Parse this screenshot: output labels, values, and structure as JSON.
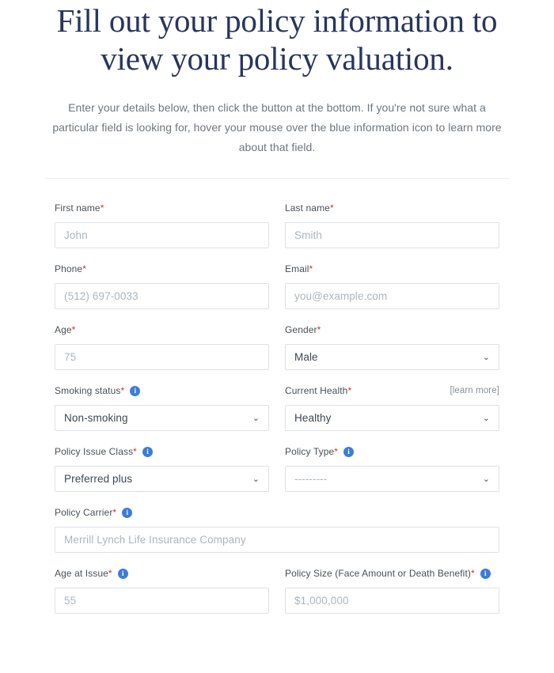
{
  "header": {
    "title": "Fill out your policy information to view your policy valuation.",
    "subtitle": "Enter your details below, then click the button at the bottom. If you're not sure what a particular field is looking for, hover your mouse over the blue information icon to learn more about that field."
  },
  "colors": {
    "heading": "#28355c",
    "subtitle": "#6e767d",
    "label": "#495057",
    "required_asterisk": "#c0392b",
    "info_icon": "#3b7dd8",
    "input_border": "#dee2e6",
    "placeholder": "#adb5bd",
    "value_text": "#3f4752",
    "divider": "#e9ecef"
  },
  "form": {
    "required_marker": "*",
    "info_icon_glyph": "i",
    "chevron_glyph": "⌄",
    "learn_more_label": "[learn more]",
    "fields": {
      "first_name": {
        "label": "First name",
        "placeholder": "John",
        "value": "",
        "type": "text",
        "required": true
      },
      "last_name": {
        "label": "Last name",
        "placeholder": "Smith",
        "value": "",
        "type": "text",
        "required": true
      },
      "phone": {
        "label": "Phone",
        "placeholder": "(512) 697-0033",
        "value": "",
        "type": "text",
        "required": true
      },
      "email": {
        "label": "Email",
        "placeholder": "you@example.com",
        "value": "",
        "type": "text",
        "required": true
      },
      "age": {
        "label": "Age",
        "placeholder": "75",
        "value": "",
        "type": "text",
        "required": true
      },
      "gender": {
        "label": "Gender",
        "value": "Male",
        "type": "select",
        "required": true
      },
      "smoking_status": {
        "label": "Smoking status",
        "value": "Non-smoking",
        "type": "select",
        "required": true,
        "has_info": true
      },
      "current_health": {
        "label": "Current Health",
        "value": "Healthy",
        "type": "select",
        "required": true,
        "learn_more": "[learn more]"
      },
      "policy_issue_class": {
        "label": "Policy Issue Class",
        "value": "Preferred plus",
        "type": "select",
        "required": true,
        "has_info": true
      },
      "policy_type": {
        "label": "Policy Type",
        "value": "---------",
        "type": "select",
        "required": true,
        "has_info": true
      },
      "policy_carrier": {
        "label": "Policy Carrier",
        "placeholder": "Merrill Lynch Life Insurance Company",
        "value": "",
        "type": "text",
        "required": true,
        "has_info": true
      },
      "age_at_issue": {
        "label": "Age at Issue",
        "placeholder": "55",
        "value": "",
        "type": "text",
        "required": true,
        "has_info": true
      },
      "policy_size": {
        "label": "Policy Size (Face Amount or Death Benefit)",
        "placeholder": "$1,000,000",
        "value": "",
        "type": "text",
        "required": true,
        "has_info": true
      }
    }
  }
}
